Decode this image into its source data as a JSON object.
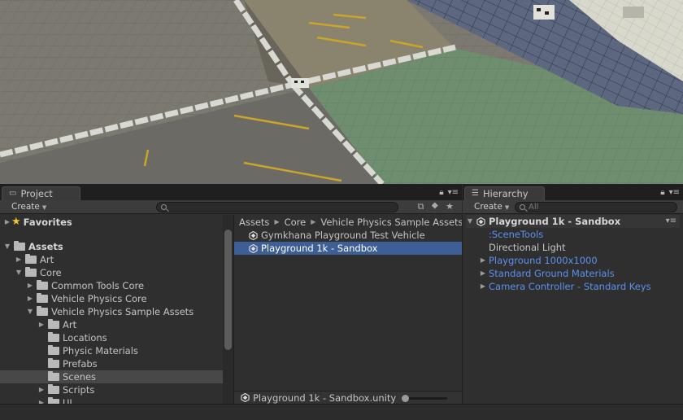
{
  "project": {
    "tab_label": "Project",
    "create_label": "Create",
    "favorites_label": "Favorites",
    "tree": [
      {
        "label": "Assets",
        "level": 0,
        "expanded": true,
        "bold": true
      },
      {
        "label": "Art",
        "level": 1,
        "expanded": false
      },
      {
        "label": "Core",
        "level": 1,
        "expanded": true
      },
      {
        "label": "Common Tools Core",
        "level": 2,
        "expanded": false
      },
      {
        "label": "Vehicle Physics Core",
        "level": 2,
        "expanded": false
      },
      {
        "label": "Vehicle Physics Sample Assets",
        "level": 2,
        "expanded": true
      },
      {
        "label": "Art",
        "level": 3,
        "expanded": false
      },
      {
        "label": "Locations",
        "level": 3
      },
      {
        "label": "Physic Materials",
        "level": 3
      },
      {
        "label": "Prefabs",
        "level": 3
      },
      {
        "label": "Scenes",
        "level": 3,
        "selected": true
      },
      {
        "label": "Scripts",
        "level": 3,
        "expanded": false
      },
      {
        "label": "UI",
        "level": 3,
        "expanded": false
      }
    ],
    "breadcrumb": [
      "Assets",
      "Core",
      "Vehicle Physics Sample Assets"
    ],
    "files": [
      {
        "label": "Gymkhana Playground Test Vehicle"
      },
      {
        "label": "Playground 1k - Sandbox",
        "selected": true
      }
    ],
    "selected_path": "Playground 1k - Sandbox.unity"
  },
  "hierarchy": {
    "tab_label": "Hierarchy",
    "create_label": "Create",
    "search_placeholder": "All",
    "scene_name": "Playground 1k - Sandbox",
    "items": [
      {
        "label": ":SceneTools",
        "color": "blue",
        "expandable": false
      },
      {
        "label": "Directional Light",
        "color": "normal",
        "expandable": false
      },
      {
        "label": "Playground 1000x1000",
        "color": "blue",
        "expandable": true
      },
      {
        "label": "Standard Ground Materials",
        "color": "blue",
        "expandable": true
      },
      {
        "label": "Camera Controller - Standard Keys",
        "color": "blue",
        "expandable": true
      }
    ]
  },
  "colors": {
    "selection": "#3e5f96",
    "prefab_text": "#5e8ff0"
  }
}
